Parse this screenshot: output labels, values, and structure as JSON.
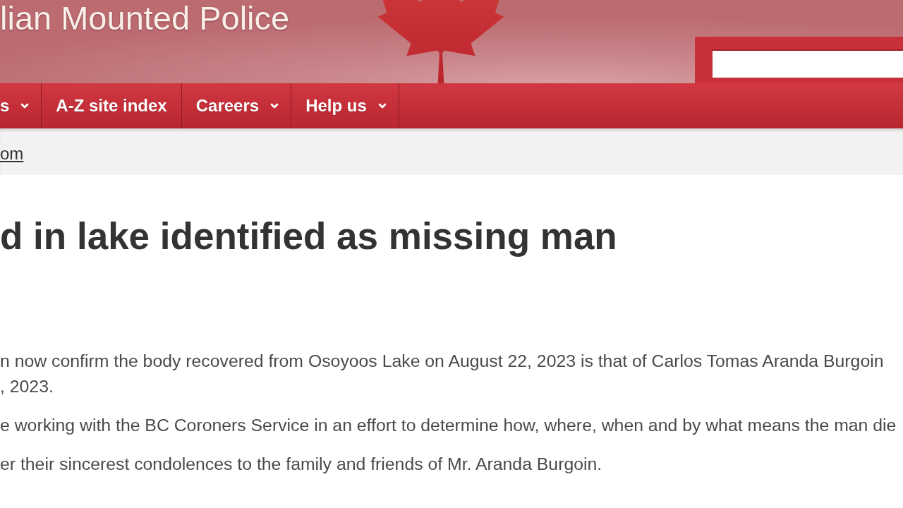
{
  "header": {
    "site_title": "lian Mounted Police"
  },
  "nav_items": [
    {
      "label": "s",
      "has_menu": true
    },
    {
      "label": "A-Z site index",
      "has_menu": false
    },
    {
      "label": "Careers",
      "has_menu": true
    },
    {
      "label": "Help us",
      "has_menu": true
    }
  ],
  "breadcrumb": [
    {
      "label": "om"
    }
  ],
  "article": {
    "title": "d in lake identified as missing man",
    "paragraphs": [
      {
        "lines": [
          "n now confirm the body recovered from Osoyoos Lake on August 22, 2023 is that of Carlos Tomas Aranda Burgoin",
          ", 2023."
        ]
      },
      {
        "lines": [
          "e working with the BC Coroners Service in an effort to determine how, where, when and by what means the man die"
        ]
      },
      {
        "lines": [
          "er their sincerest condolences to the family and friends of Mr. Aranda Burgoin."
        ]
      }
    ]
  }
}
